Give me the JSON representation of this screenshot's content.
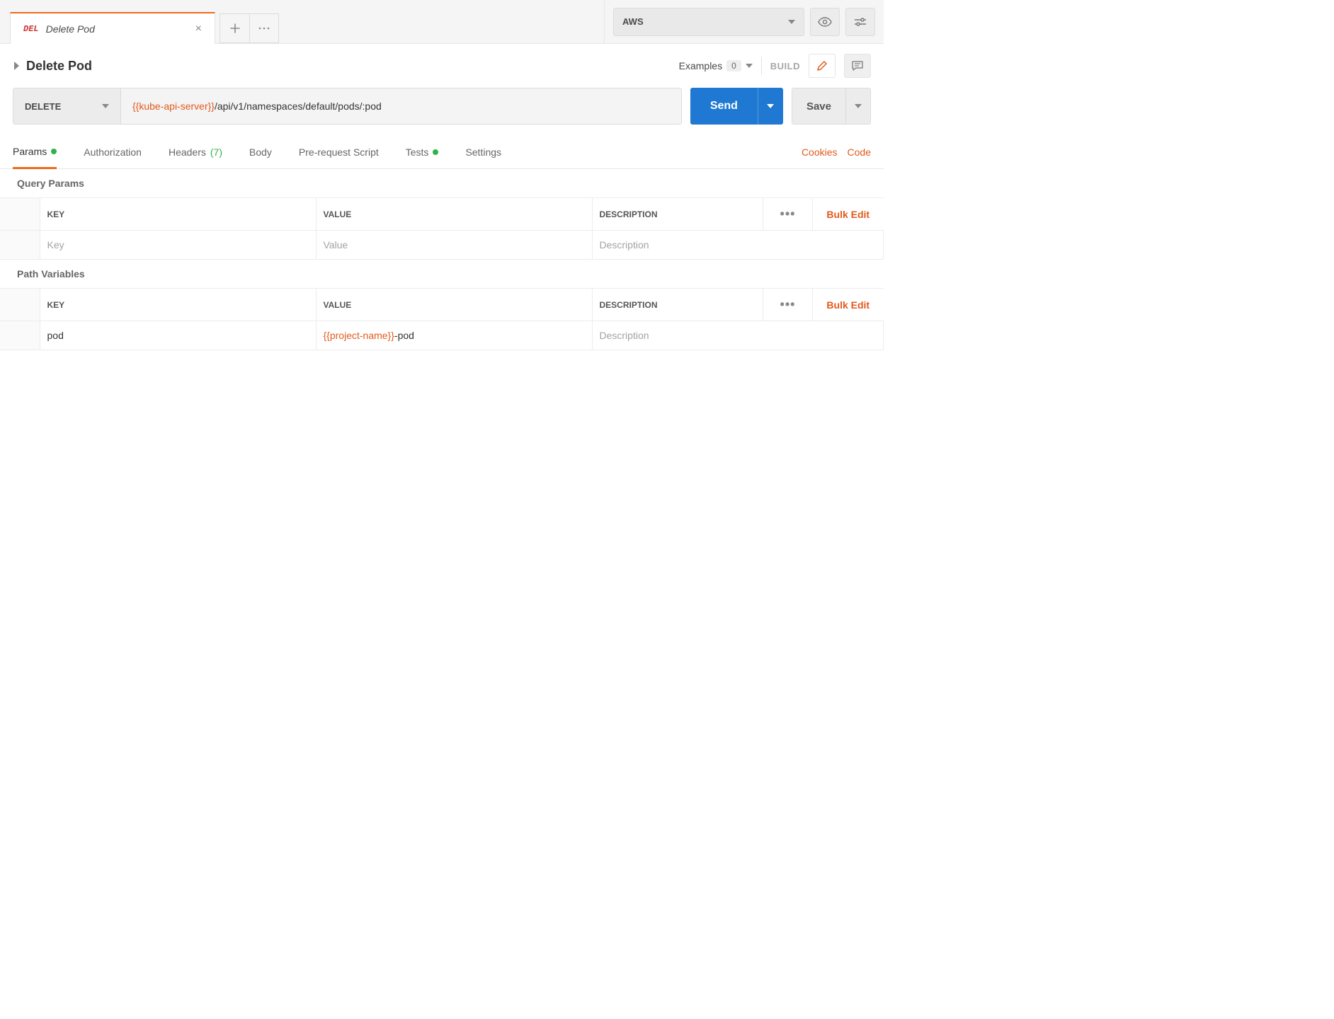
{
  "tab": {
    "method": "DEL",
    "title": "Delete Pod"
  },
  "env": {
    "selected": "AWS"
  },
  "request": {
    "title": "Delete Pod",
    "examples_label": "Examples",
    "examples_count": "0",
    "build_label": "BUILD",
    "method": "DELETE",
    "url_var": "{{kube-api-server}}",
    "url_rest": "/api/v1/namespaces/default/pods/:pod",
    "send_label": "Send",
    "save_label": "Save"
  },
  "subtabs": {
    "params": "Params",
    "authorization": "Authorization",
    "headers": "Headers",
    "headers_count": "(7)",
    "body": "Body",
    "prerequest": "Pre-request Script",
    "tests": "Tests",
    "settings": "Settings",
    "cookies": "Cookies",
    "code": "Code"
  },
  "sections": {
    "query_params": "Query Params",
    "path_variables": "Path Variables",
    "bulk_edit": "Bulk Edit"
  },
  "columns": {
    "key": "KEY",
    "value": "VALUE",
    "description": "DESCRIPTION"
  },
  "placeholders": {
    "key": "Key",
    "value": "Value",
    "description": "Description"
  },
  "path_vars": [
    {
      "key": "pod",
      "value_var": "{{project-name}}",
      "value_rest": "-pod",
      "description": ""
    }
  ]
}
